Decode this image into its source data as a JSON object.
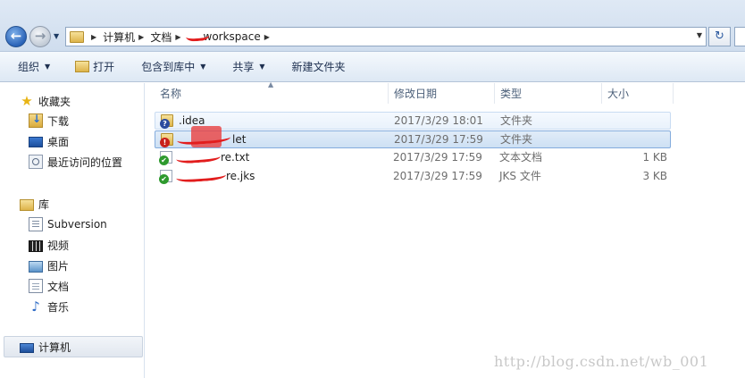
{
  "breadcrumb": {
    "items": [
      "计算机",
      "文档",
      "workspace"
    ]
  },
  "toolbar": {
    "organize": "组织",
    "open": "打开",
    "include_in_library": "包含到库中",
    "share": "共享",
    "new_folder": "新建文件夹"
  },
  "navpane": {
    "favorites": "收藏夹",
    "downloads": "下载",
    "desktop": "桌面",
    "recent": "最近访问的位置",
    "libraries": "库",
    "subversion": "Subversion",
    "videos": "视频",
    "pictures": "图片",
    "documents": "文档",
    "music": "音乐",
    "computer": "计算机"
  },
  "columns": {
    "name": "名称",
    "date": "修改日期",
    "type": "类型",
    "size": "大小"
  },
  "files": [
    {
      "name": ".idea",
      "date": "2017/3/29 18:01",
      "type": "文件夹",
      "size": "",
      "badge": "?"
    },
    {
      "name": "let",
      "date": "2017/3/29 17:59",
      "type": "文件夹",
      "size": "",
      "badge": "!"
    },
    {
      "name": "re.txt",
      "date": "2017/3/29 17:59",
      "type": "文本文档",
      "size": "1 KB",
      "badge": "✔"
    },
    {
      "name": "re.jks",
      "date": "2017/3/29 17:59",
      "type": "JKS 文件",
      "size": "3 KB",
      "badge": "✔"
    }
  ],
  "watermark": "http://blog.csdn.net/wb_001",
  "colors": {
    "selection": "#cde0f4",
    "redaction": "#e21d1d"
  }
}
